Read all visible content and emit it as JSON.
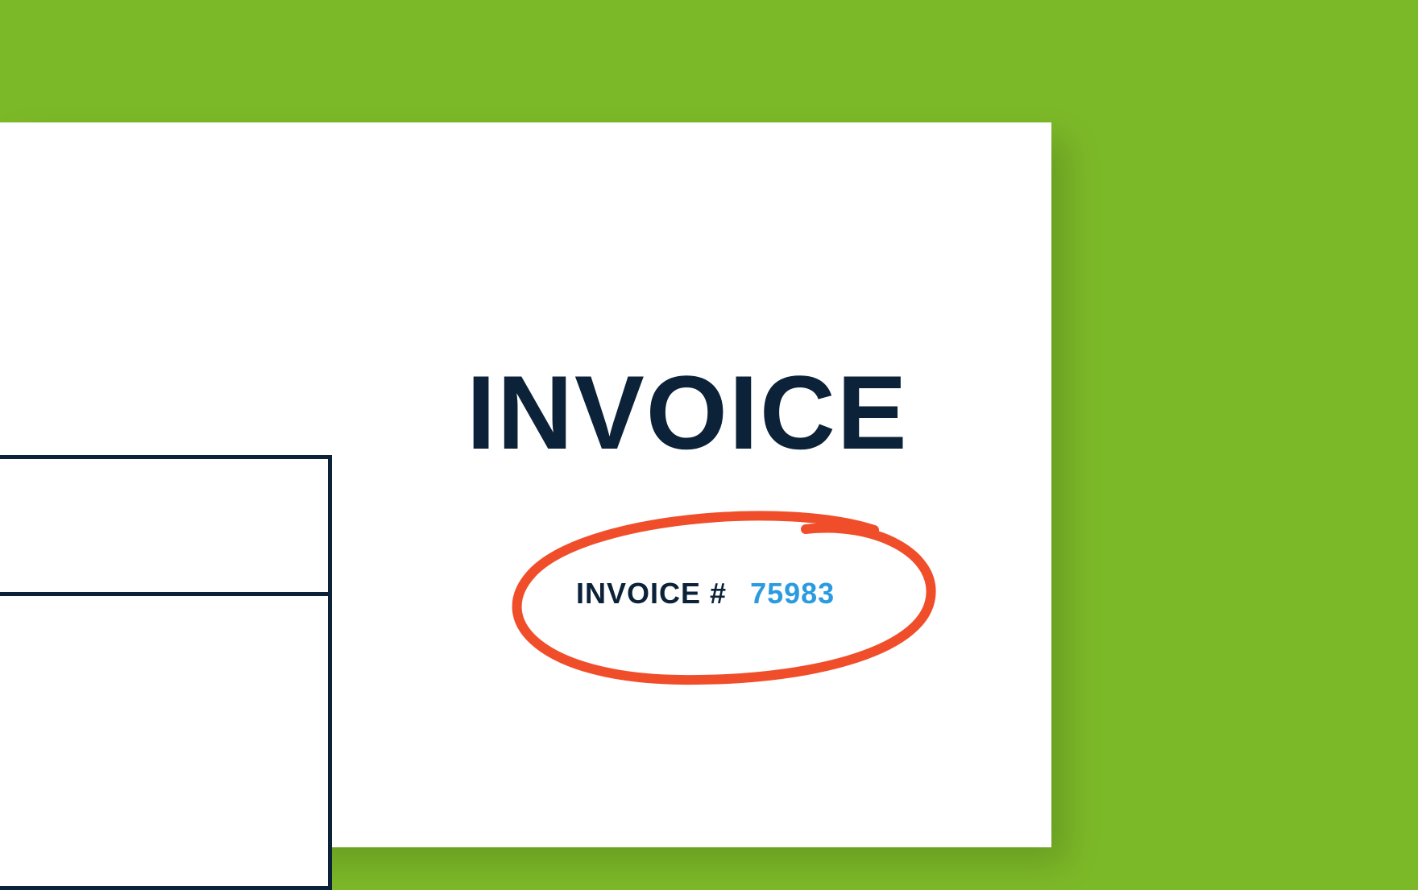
{
  "invoice": {
    "title": "INVOICE",
    "number_label": "INVOICE #",
    "number": "75983"
  },
  "colors": {
    "background": "#7cb928",
    "text": "#0b2238",
    "accent": "#2b9be0",
    "highlight": "#f04e2a"
  }
}
